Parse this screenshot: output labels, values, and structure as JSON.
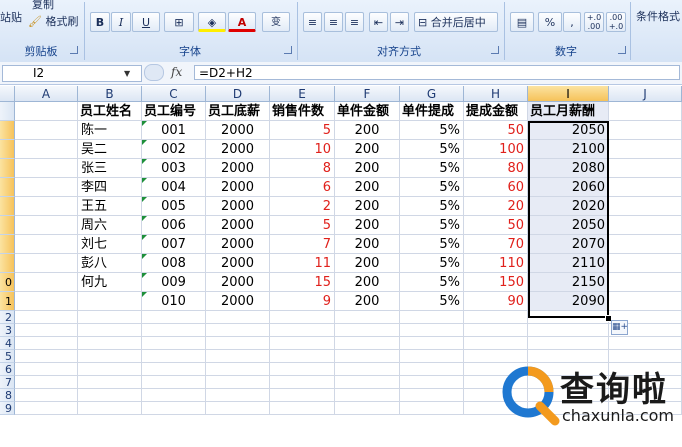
{
  "ribbon": {
    "groups": [
      {
        "label": "剪贴板"
      },
      {
        "label": "字体"
      },
      {
        "label": "对齐方式"
      },
      {
        "label": "数字"
      }
    ],
    "clipboard": {
      "paste_partial": "站贴",
      "copy_partial": "复制",
      "format_painter": "格式刷"
    },
    "font": {
      "bold": "B",
      "italic": "I",
      "underline": "U",
      "color_letter": "A",
      "phonetic": "变"
    },
    "alignment": {
      "merge_center": "合并后居中"
    },
    "number": {
      "percent": "%",
      "comma": ",",
      "inc_decimal": "+.0\n.00",
      "dec_decimal": ".00\n+.0"
    },
    "styles": {
      "conditional_format": "条件格式"
    }
  },
  "formula_bar": {
    "name_box": "I2",
    "fx": "fx",
    "formula": "=D2+H2"
  },
  "columns": [
    "A",
    "B",
    "C",
    "D",
    "E",
    "F",
    "G",
    "H",
    "I",
    "J"
  ],
  "selected_column": "I",
  "row_numbers": [
    "",
    "",
    "",
    "",
    "",
    "",
    "",
    "",
    "",
    "0",
    "1",
    "2",
    "3",
    "4",
    "5",
    "6",
    "7",
    "8",
    "9"
  ],
  "sheet": {
    "headers": [
      "员工姓名",
      "员工编号",
      "员工底薪",
      "销售件数",
      "单件金额",
      "单件提成",
      "提成金额",
      "员工月薪酬"
    ],
    "rows": [
      {
        "name": "陈一",
        "id": "001",
        "base": "2000",
        "qty": "5",
        "price": "200",
        "rate": "5%",
        "commission": "50",
        "salary": "2050"
      },
      {
        "name": "吴二",
        "id": "002",
        "base": "2000",
        "qty": "10",
        "price": "200",
        "rate": "5%",
        "commission": "100",
        "salary": "2100"
      },
      {
        "name": "张三",
        "id": "003",
        "base": "2000",
        "qty": "8",
        "price": "200",
        "rate": "5%",
        "commission": "80",
        "salary": "2080"
      },
      {
        "name": "李四",
        "id": "004",
        "base": "2000",
        "qty": "6",
        "price": "200",
        "rate": "5%",
        "commission": "60",
        "salary": "2060"
      },
      {
        "name": "王五",
        "id": "005",
        "base": "2000",
        "qty": "2",
        "price": "200",
        "rate": "5%",
        "commission": "20",
        "salary": "2020"
      },
      {
        "name": "周六",
        "id": "006",
        "base": "2000",
        "qty": "5",
        "price": "200",
        "rate": "5%",
        "commission": "50",
        "salary": "2050"
      },
      {
        "name": "刘七",
        "id": "007",
        "base": "2000",
        "qty": "7",
        "price": "200",
        "rate": "5%",
        "commission": "70",
        "salary": "2070"
      },
      {
        "name": "彭八",
        "id": "008",
        "base": "2000",
        "qty": "11",
        "price": "200",
        "rate": "5%",
        "commission": "110",
        "salary": "2110"
      },
      {
        "name": "何九",
        "id": "009",
        "base": "2000",
        "qty": "15",
        "price": "200",
        "rate": "5%",
        "commission": "150",
        "salary": "2150"
      },
      {
        "name": "",
        "id": "010",
        "base": "2000",
        "qty": "9",
        "price": "200",
        "rate": "5%",
        "commission": "90",
        "salary": "2090"
      }
    ]
  },
  "watermark": {
    "title": "查询啦",
    "url": "chaxunla.com"
  },
  "colors": {
    "accent_red": "#e0201b",
    "selection_orange": "#f6c25a",
    "watermark_blue": "#1f78d1",
    "watermark_orange": "#f39a1e"
  }
}
